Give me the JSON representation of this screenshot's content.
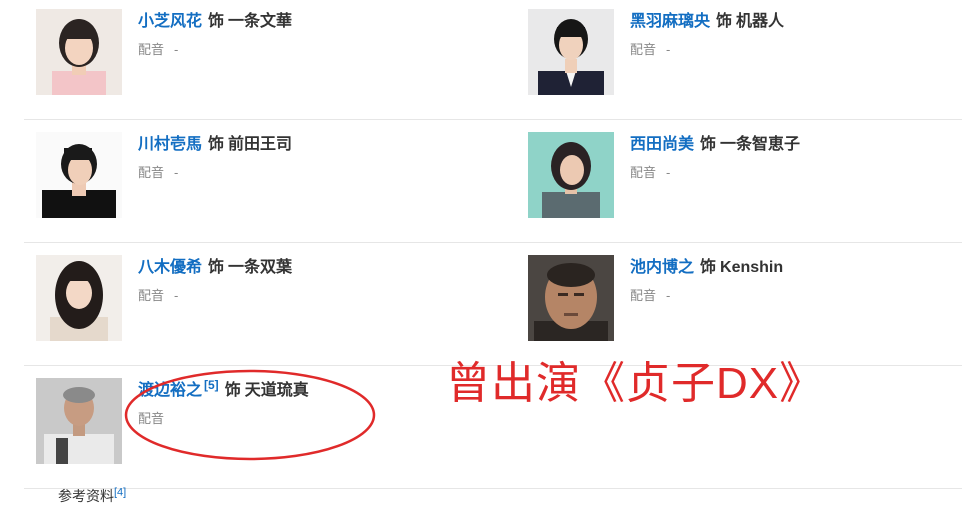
{
  "cast": [
    [
      {
        "actor": "小芝风花",
        "ref": "",
        "as": "饰",
        "role": "一条文華",
        "voice_label": "配音",
        "voice_value": "-",
        "photo": "woman-short-hair"
      },
      {
        "actor": "黑羽麻璃央",
        "ref": "",
        "as": "饰",
        "role": "机器人",
        "voice_label": "配音",
        "voice_value": "-",
        "photo": "man-suit"
      }
    ],
    [
      {
        "actor": "川村壱馬",
        "ref": "",
        "as": "饰",
        "role": "前田王司",
        "voice_label": "配音",
        "voice_value": "-",
        "photo": "man-dark-jacket"
      },
      {
        "actor": "西田尚美",
        "ref": "",
        "as": "饰",
        "role": "一条智恵子",
        "voice_label": "配音",
        "voice_value": "-",
        "photo": "woman-teal-bg"
      }
    ],
    [
      {
        "actor": "八木優希",
        "ref": "",
        "as": "饰",
        "role": "一条双葉",
        "voice_label": "配音",
        "voice_value": "-",
        "photo": "woman-long-hair"
      },
      {
        "actor": "池内博之",
        "ref": "",
        "as": "饰",
        "role": "Kenshin",
        "voice_label": "配音",
        "voice_value": "-",
        "photo": "man-close-up"
      }
    ],
    [
      {
        "actor": "渡边裕之",
        "ref": "[5]",
        "as": "饰",
        "role": "天道琉真",
        "voice_label": "配音",
        "voice_value": "",
        "photo": "man-gray-hair"
      }
    ]
  ],
  "annotation": {
    "text": "曾出演《贞子DX》",
    "color": "#e02a2a"
  },
  "footer": {
    "label": "参考资料",
    "ref": "[4]"
  },
  "colors": {
    "link": "#136ec2",
    "text": "#333333",
    "muted": "#888888",
    "divider": "#e6e6e6"
  }
}
